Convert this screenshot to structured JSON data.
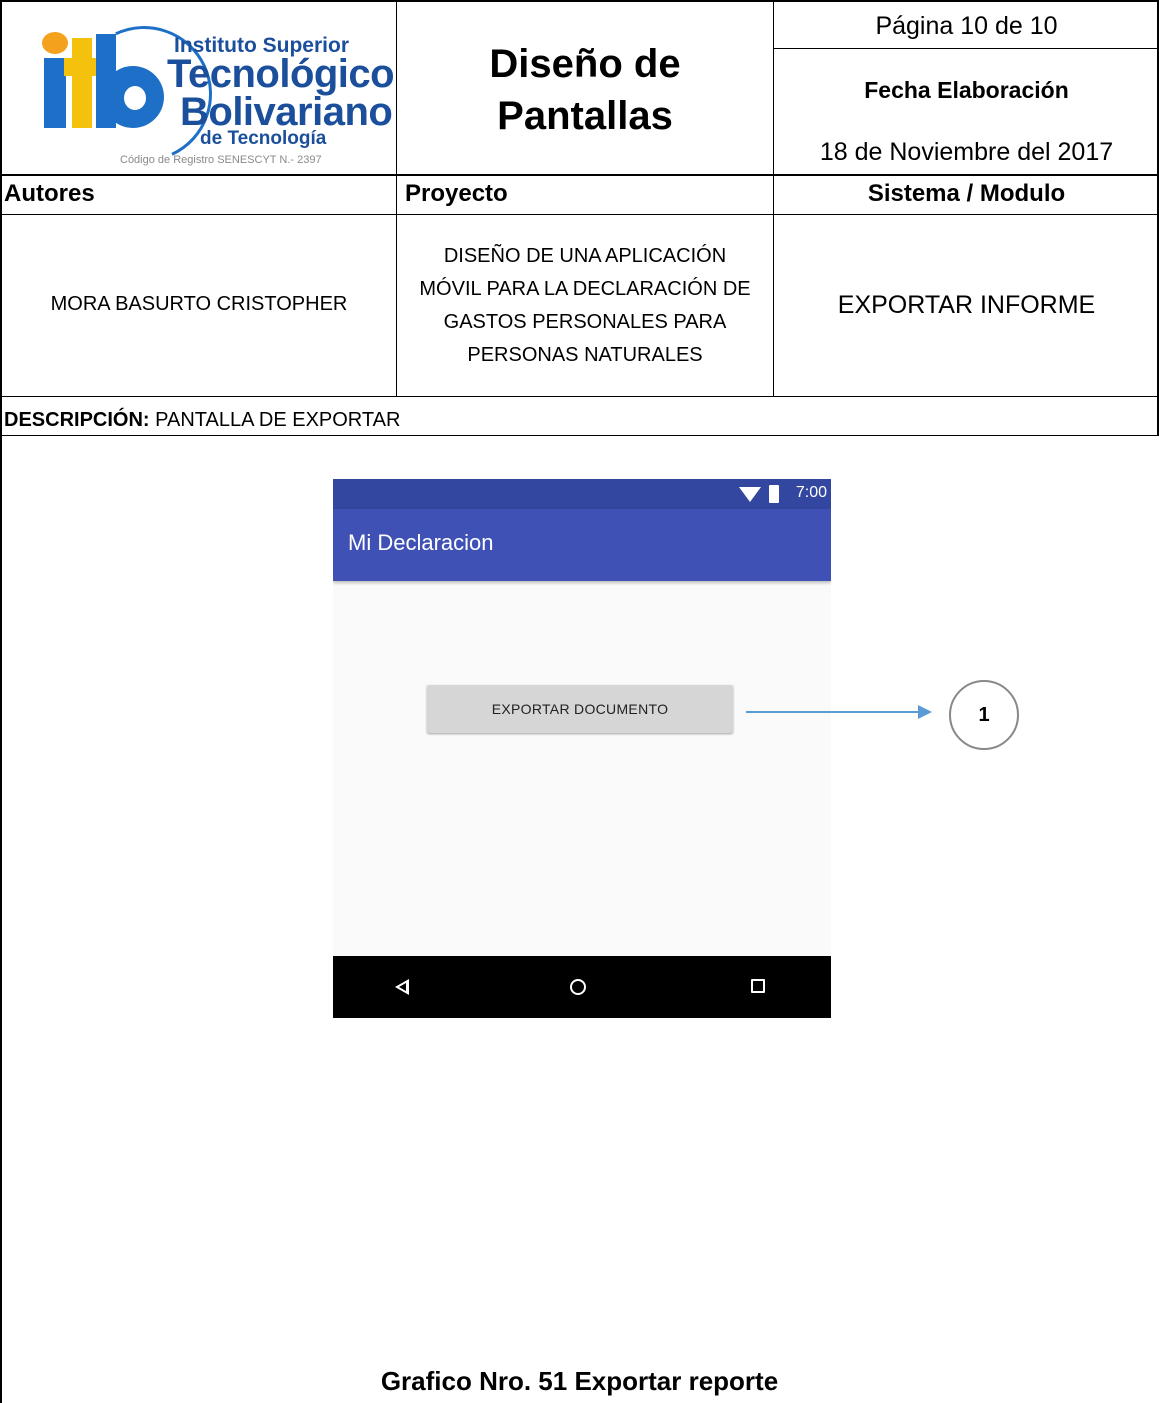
{
  "logo": {
    "line1": "Instituto Superior",
    "line2": "Tecnológico",
    "line3": "Bolivariano",
    "line4": "de Tecnología",
    "line5": "Código de Registro SENESCYT N.- 2397"
  },
  "header": {
    "title": "Diseño de Pantallas",
    "page": "Página 10 de 10",
    "date_label": "Fecha Elaboración",
    "date_value": "18 de Noviembre del 2017"
  },
  "table": {
    "col1_header": "Autores",
    "col2_header": "Proyecto",
    "col3_header": "Sistema / Modulo",
    "author": "MORA BASURTO CRISTOPHER",
    "project": "DISEÑO DE UNA APLICACIÓN MÓVIL PARA LA DECLARACIÓN DE GASTOS PERSONALES PARA PERSONAS NATURALES",
    "module": "EXPORTAR INFORME",
    "description_label": "DESCRIPCIÓN:",
    "description_value": " PANTALLA DE EXPORTAR"
  },
  "phone": {
    "status_time": "7:00",
    "app_title": "Mi Declaracion",
    "button_label": "EXPORTAR DOCUMENTO",
    "nav_icons": [
      "back-icon",
      "home-icon",
      "recents-icon"
    ]
  },
  "callout": {
    "number": "1",
    "color": "#5b9bd5"
  },
  "caption": "Grafico Nro. 51 Exportar reporte"
}
